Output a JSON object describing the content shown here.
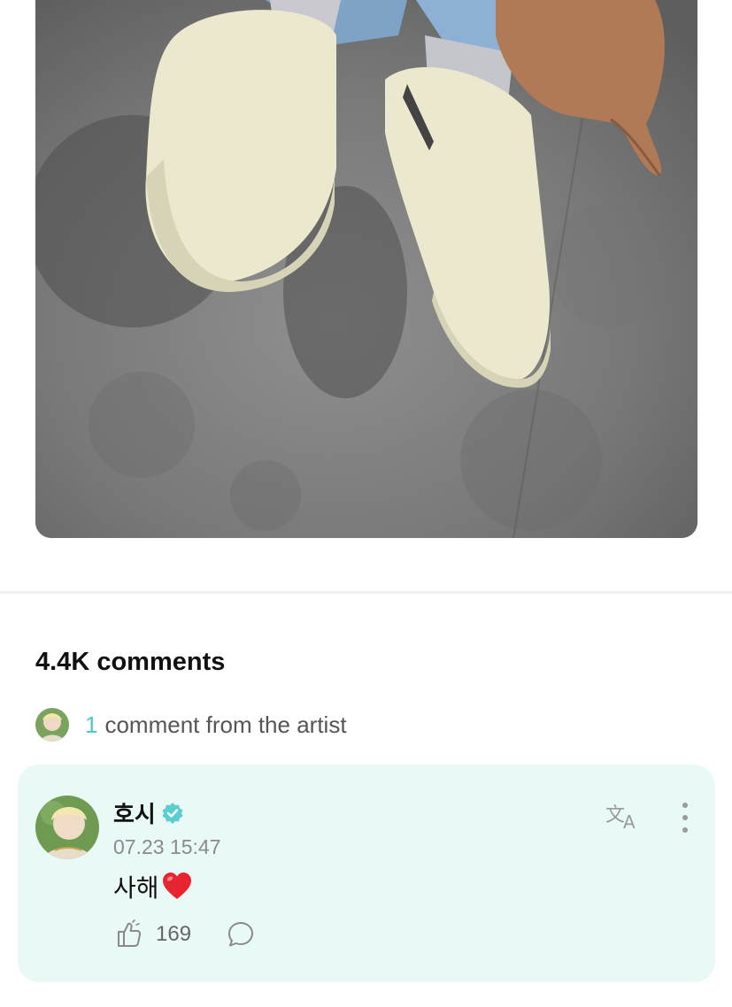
{
  "post": {
    "photo_alt": ""
  },
  "comments": {
    "count_label": "4.4K comments",
    "artist_count": "1",
    "artist_label": "comment from the artist"
  },
  "comment": {
    "author": "호시",
    "timestamp": "07.23 15:47",
    "text": "사해",
    "like_count": "169"
  },
  "colors": {
    "accent": "#4fc7c2",
    "card_bg": "#e9f9f6",
    "verified": "#5bcfd0"
  },
  "icons": {
    "verified": "verified-badge-icon",
    "translate": "translate-icon",
    "more": "more-vertical-icon",
    "like": "like-hand-icon",
    "reply": "comment-bubble-icon",
    "emoji": "red-heart-emoji"
  }
}
